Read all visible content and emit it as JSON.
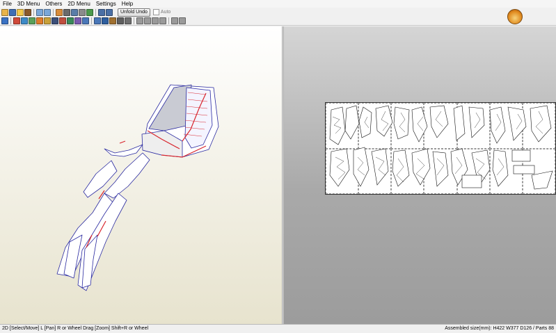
{
  "menu": [
    "File",
    "3D Menu",
    "Others",
    "2D Menu",
    "Settings",
    "Help"
  ],
  "toolbar": {
    "row1_icons": [
      {
        "name": "open-icon",
        "color": "#e9b44a"
      },
      {
        "name": "save-icon",
        "color": "#3f6fb5"
      },
      {
        "name": "three-d-view-icon",
        "color": "#f2c94c"
      },
      {
        "name": "object-icon",
        "color": "#8a5a2b"
      },
      {
        "name": "undo-icon",
        "color": "#7aa7d8"
      },
      {
        "name": "redo-icon",
        "color": "#7aa7d8"
      },
      {
        "name": "pencil-icon",
        "color": "#d98c3a"
      },
      {
        "name": "delete-icon",
        "color": "#6b6b6b"
      },
      {
        "name": "join-icon",
        "color": "#5a7da8"
      },
      {
        "name": "fold-icon",
        "color": "#8b8b8b"
      },
      {
        "name": "image-icon",
        "color": "#4c9a4c"
      },
      {
        "name": "window-icon",
        "color": "#4a6fa5"
      },
      {
        "name": "frame-icon",
        "color": "#4a6fa5"
      }
    ],
    "unfold_undo_label": "Unfold Undo",
    "auto_label": "Auto",
    "row2_icons": [
      {
        "name": "select-icon",
        "color": "#3a72c4"
      },
      {
        "name": "edge-icon",
        "color": "#d04a3a"
      },
      {
        "name": "texture-icon",
        "color": "#3d8ac7"
      },
      {
        "name": "paint-icon",
        "color": "#5aa05a"
      },
      {
        "name": "flaps-icon",
        "color": "#e07b2a"
      },
      {
        "name": "book-icon",
        "color": "#c9a13a"
      },
      {
        "name": "film-icon",
        "color": "#3b4f7a"
      },
      {
        "name": "rotate-icon",
        "color": "#c04f3f"
      },
      {
        "name": "flip-icon",
        "color": "#3a8a5a"
      },
      {
        "name": "split-icon",
        "color": "#7a5ab0"
      },
      {
        "name": "grid-icon",
        "color": "#4a77b8"
      },
      {
        "name": "grid-dense-icon",
        "color": "#4a77b8"
      },
      {
        "name": "text-icon",
        "color": "#2f5f9f"
      },
      {
        "name": "chart-icon",
        "color": "#a07030"
      },
      {
        "name": "table-icon",
        "color": "#5f5f5f"
      },
      {
        "name": "print-icon",
        "color": "#6f6f6f"
      },
      {
        "name": "arrange-left-icon",
        "color": "#9a9a9a"
      },
      {
        "name": "arrange-right-icon",
        "color": "#9a9a9a"
      },
      {
        "name": "arrange-top-icon",
        "color": "#9a9a9a"
      },
      {
        "name": "arrange-bottom-icon",
        "color": "#9a9a9a"
      },
      {
        "name": "zoom-icon",
        "color": "#9a9a9a"
      },
      {
        "name": "pan-icon",
        "color": "#9a9a9a"
      }
    ]
  },
  "status": {
    "left": "2D [Select/Move] L [Pan] R or Wheel Drag [Zoom] Shift+R or Wheel",
    "right": "Assembled size(mm): H422 W377 D126 / Parts 88"
  }
}
